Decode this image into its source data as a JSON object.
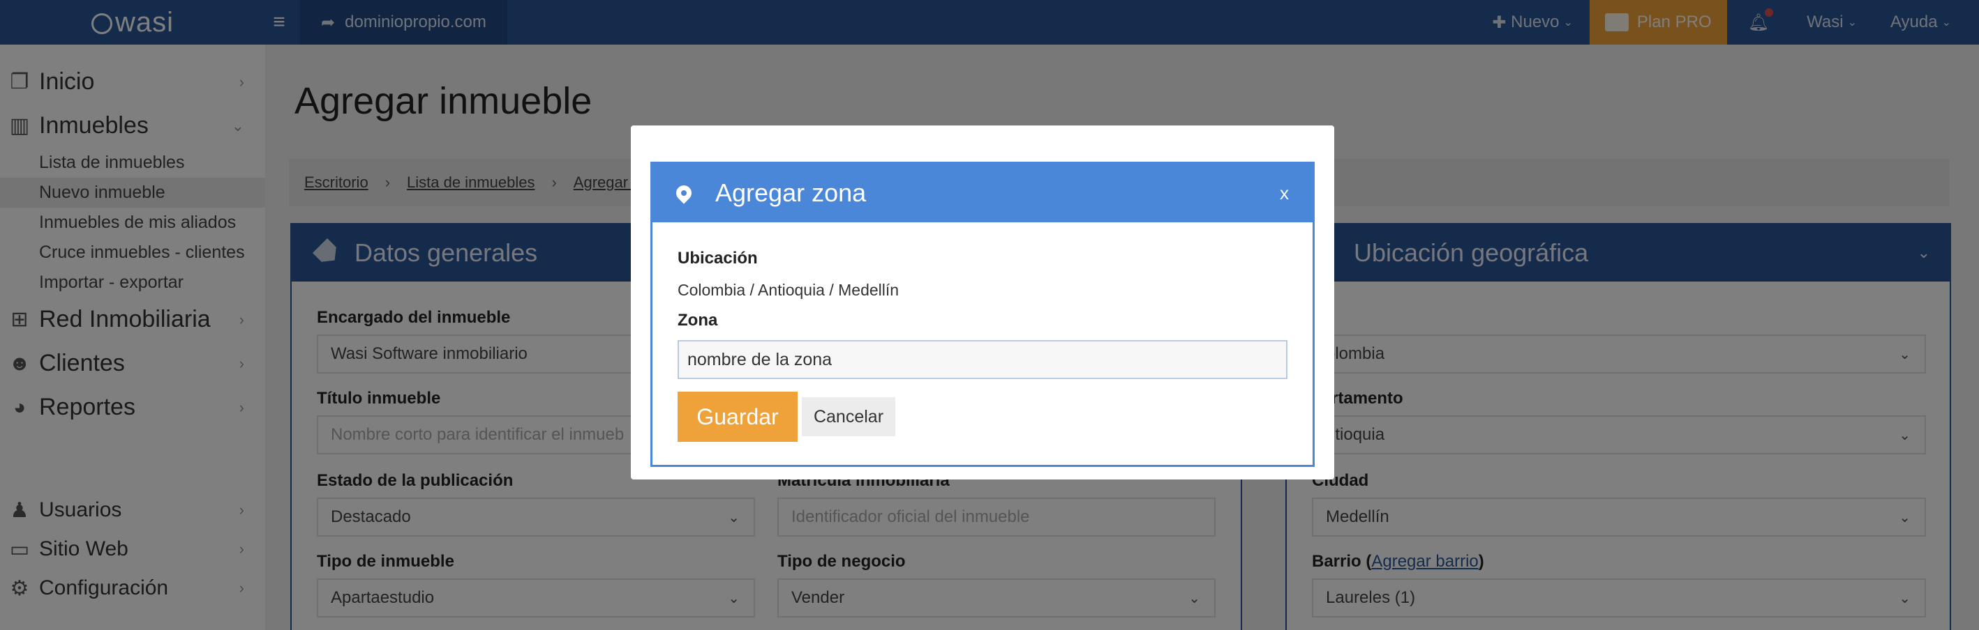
{
  "topbar": {
    "logo": "wasi",
    "domain": "dominiopropio.com",
    "nuevo": "Nuevo",
    "plan": "Plan PRO",
    "user": "Wasi",
    "help": "Ayuda"
  },
  "sidebar": {
    "inicio": "Inicio",
    "inmuebles": "Inmuebles",
    "sub": [
      "Lista de inmuebles",
      "Nuevo inmueble",
      "Inmuebles de mis aliados",
      "Cruce inmuebles - clientes",
      "Importar - exportar"
    ],
    "red": "Red Inmobiliaria",
    "clientes": "Clientes",
    "reportes": "Reportes",
    "usuarios": "Usuarios",
    "sitio": "Sitio Web",
    "config": "Configuración"
  },
  "main": {
    "title": "Agregar inmueble",
    "breadcrumb": [
      "Escritorio",
      "Lista de inmuebles",
      "Agregar nu"
    ],
    "panel_general": "Datos generales",
    "panel_geo": "Ubicación geográfica",
    "fields": {
      "encargado_label": "Encargado del inmueble",
      "encargado_value": "Wasi Software inmobiliario",
      "titulo_label": "Título inmueble",
      "titulo_placeholder": "Nombre corto para identificar el inmueb",
      "estado_label": "Estado de la publicación",
      "estado_value": "Destacado",
      "matricula_label": "Matrícula inmobiliaria",
      "matricula_placeholder": "Identificador oficial del inmueble",
      "tipo_label": "Tipo de inmueble",
      "tipo_value": "Apartaestudio",
      "negocio_label": "Tipo de negocio",
      "negocio_value": "Vender",
      "pais_label": "ís",
      "pais_value": "olombia",
      "depto_label": "partamento",
      "depto_value": "ntioquia",
      "ciudad_label": "Ciudad",
      "ciudad_value": "Medellín",
      "barrio_label": "Barrio (",
      "barrio_link": "Agregar barrio",
      "barrio_close": ")",
      "barrio_value": "Laureles (1)"
    }
  },
  "modal": {
    "title": "Agregar zona",
    "close": "x",
    "ubicacion_label": "Ubicación",
    "ubicacion_value": "Colombia / Antioquia / Medellín",
    "zona_label": "Zona",
    "zona_value": "nombre de la zona",
    "save": "Guardar",
    "cancel": "Cancelar"
  }
}
